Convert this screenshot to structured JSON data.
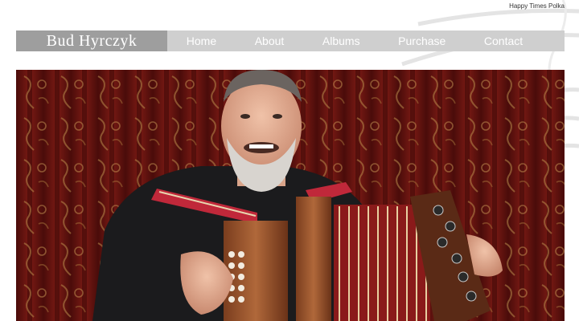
{
  "site": {
    "tagline": "Happy Times Polka",
    "brand": "Bud Hyrczyk"
  },
  "nav": {
    "items": [
      {
        "label": "Home"
      },
      {
        "label": "About"
      },
      {
        "label": "Albums"
      },
      {
        "label": "Purchase"
      },
      {
        "label": "Contact"
      }
    ]
  },
  "colors": {
    "nav_bar": "#cfcfcf",
    "brand_block": "#9e9e9e",
    "curtain": "#6b1410"
  }
}
